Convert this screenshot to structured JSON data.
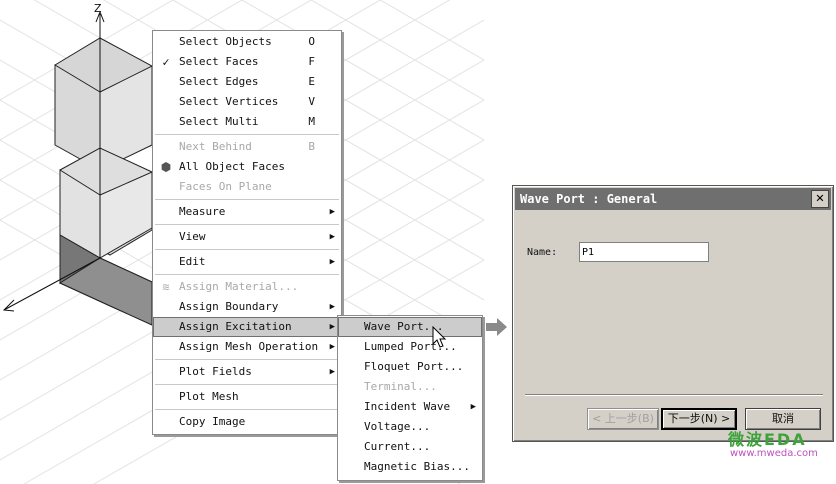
{
  "viewport": {
    "axis_z_label": "Z"
  },
  "context_menu": {
    "items": [
      {
        "label": "Select Objects",
        "accel": "O",
        "checked": false
      },
      {
        "label": "Select Faces",
        "accel": "F",
        "checked": true
      },
      {
        "label": "Select Edges",
        "accel": "E"
      },
      {
        "label": "Select Vertices",
        "accel": "V"
      },
      {
        "label": "Select Multi",
        "accel": "M"
      },
      {
        "label": "Next Behind",
        "accel": "B",
        "disabled": true
      },
      {
        "label": "All Object Faces",
        "icon": "cube-icon"
      },
      {
        "label": "Faces On Plane",
        "disabled": true
      },
      {
        "label": "Measure",
        "submenu": true
      },
      {
        "label": "View",
        "submenu": true
      },
      {
        "label": "Edit",
        "submenu": true
      },
      {
        "label": "Assign Material...",
        "disabled": true,
        "icon": "material-icon"
      },
      {
        "label": "Assign Boundary",
        "submenu": true
      },
      {
        "label": "Assign Excitation",
        "submenu": true,
        "highlighted": true
      },
      {
        "label": "Assign Mesh Operation",
        "submenu": true
      },
      {
        "label": "Plot Fields",
        "submenu": true
      },
      {
        "label": "Plot Mesh"
      },
      {
        "label": "Copy Image"
      }
    ]
  },
  "excitation_submenu": {
    "items": [
      {
        "label": "Wave Port...",
        "highlighted": true
      },
      {
        "label": "Lumped Port..."
      },
      {
        "label": "Floquet Port..."
      },
      {
        "label": "Terminal...",
        "disabled": true
      },
      {
        "label": "Incident Wave",
        "submenu": true
      },
      {
        "label": "Voltage..."
      },
      {
        "label": "Current..."
      },
      {
        "label": "Magnetic Bias..."
      }
    ]
  },
  "dialog": {
    "title": "Wave Port : General",
    "close_glyph": "✕",
    "name_label": "Name:",
    "name_value": "P1",
    "back_button": "< 上一步(B)",
    "next_button": "下一步(N) >",
    "cancel_button": "取消"
  },
  "watermark": {
    "text": "微波EDA",
    "url": "www.mweda.com"
  },
  "colors": {
    "highlight": "#cccccc",
    "titlebar": "#6f6f6f",
    "dialog_bg": "#d4d0c8"
  }
}
